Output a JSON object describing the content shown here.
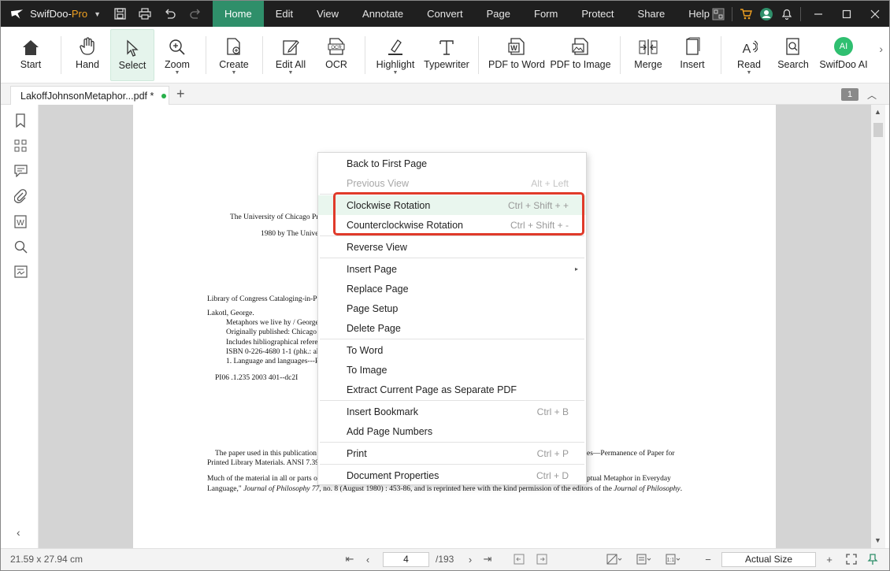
{
  "app": {
    "name": "SwifDoo-",
    "edition": "Pro"
  },
  "menubar": {
    "items": [
      "Home",
      "Edit",
      "View",
      "Annotate",
      "Convert",
      "Page",
      "Form",
      "Protect",
      "Share",
      "Help"
    ],
    "active": "Home"
  },
  "toolbar": {
    "start": "Start",
    "hand": "Hand",
    "select": "Select",
    "zoom": "Zoom",
    "create": "Create",
    "edit_all": "Edit All",
    "ocr": "OCR",
    "highlight": "Highlight",
    "typewriter": "Typewriter",
    "pdf_to_word": "PDF to Word",
    "pdf_to_image": "PDF to Image",
    "merge": "Merge",
    "insert": "Insert",
    "read": "Read",
    "search": "Search",
    "swifdoo_ai": "SwifDoo AI",
    "ai_badge": "AI"
  },
  "tabs": {
    "document_tab": "LakoffJohnsonMetaphor...pdf *",
    "page_badge": "1"
  },
  "document": {
    "lines": [
      "The University of Chicago Pr",
      "1980 by The Unive",
      "Library of Congress Cataloging-in-Pu",
      "Lakotl, George.",
      "Metaphors we live hy / George",
      "Originally published: Chicago",
      "Includes hibliographical referen",
      "ISBN 0-226-4680 1-1 (phk.: all",
      "1. Language and languages---P",
      "PI06 .1.235 2003 401--dc2I",
      "The paper used in this publication",
      "Printed Library Materials. ANSI 7.39",
      "Much of the material in all or parts of",
      "Language,\" ",
      "Journal of Philosophy 77",
      ", no. 8 (August 1980) : 453-86, and is reprinted here with the kind permission of the editors of the ",
      "Journal of Philosophy",
      ".",
      "es—Permanence of Paper for",
      "ptual Metaphor in Everyday"
    ]
  },
  "context_menu": {
    "back_to_first_page": "Back to First Page",
    "previous_view": "Previous View",
    "previous_view_shortcut": "Alt + Left",
    "clockwise_rotation": "Clockwise Rotation",
    "clockwise_shortcut": "Ctrl + Shift + +",
    "counterclockwise_rotation": "Counterclockwise Rotation",
    "counterclockwise_shortcut": "Ctrl + Shift + -",
    "reverse_view": "Reverse View",
    "insert_page": "Insert Page",
    "replace_page": "Replace Page",
    "page_setup": "Page Setup",
    "delete_page": "Delete Page",
    "to_word": "To Word",
    "to_image": "To Image",
    "extract_page": "Extract Current Page as Separate PDF",
    "insert_bookmark": "Insert Bookmark",
    "insert_bookmark_shortcut": "Ctrl + B",
    "add_page_numbers": "Add Page Numbers",
    "print": "Print",
    "print_shortcut": "Ctrl + P",
    "document_properties": "Document Properties",
    "document_properties_shortcut": "Ctrl + D"
  },
  "statusbar": {
    "page_size": "21.59 x 27.94 cm",
    "current_page": "4",
    "total_pages": "/193",
    "zoom": "Actual Size"
  },
  "colors": {
    "accent": "#2f8f6a",
    "highlight_box": "#e03a2a",
    "titlebar": "#1f1f1f"
  }
}
